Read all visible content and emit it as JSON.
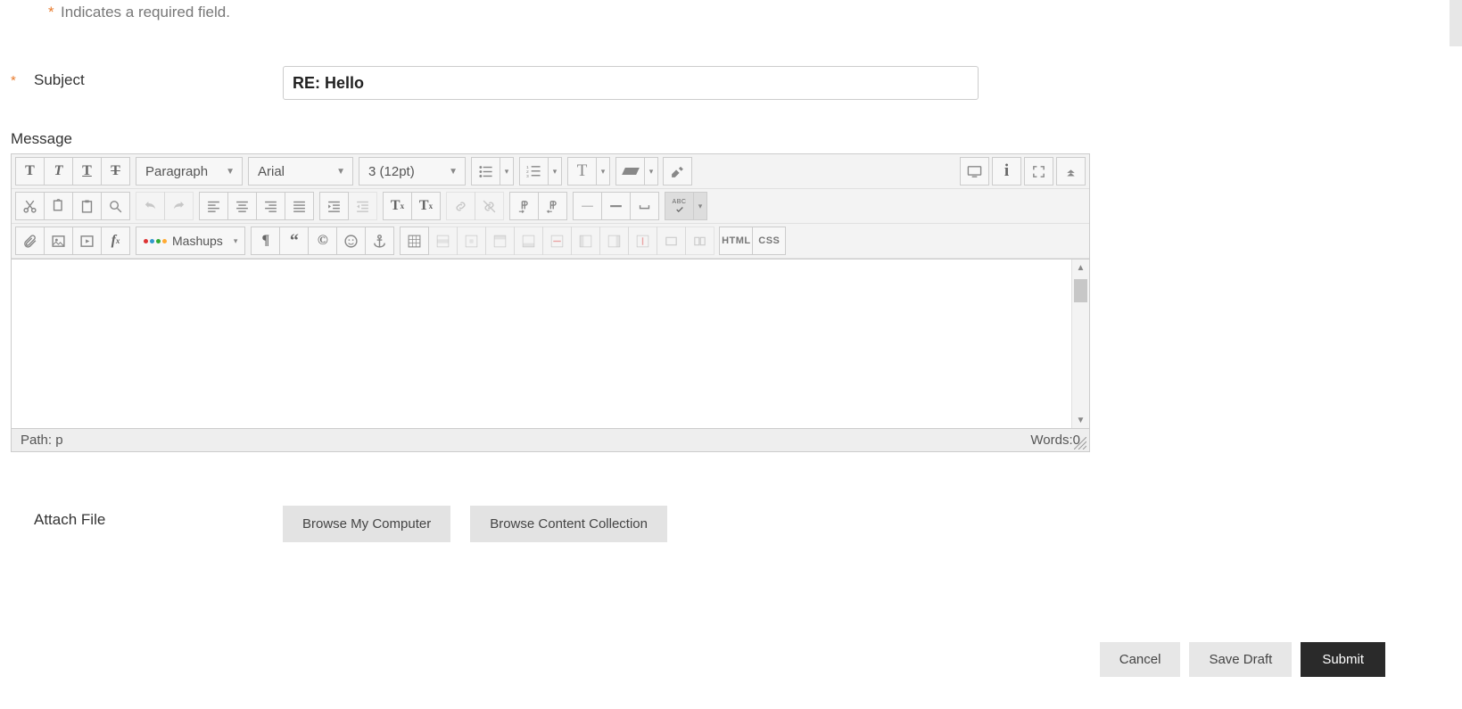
{
  "required_note": {
    "asterisk": "*",
    "text": "Indicates a required field."
  },
  "subject": {
    "asterisk": "*",
    "label": "Subject",
    "value": "RE: Hello"
  },
  "message": {
    "label": "Message"
  },
  "toolbar": {
    "format_select": "Paragraph",
    "font_select": "Arial",
    "size_select": "3 (12pt)",
    "mashups_label": "Mashups",
    "html_label": "HTML",
    "css_label": "CSS"
  },
  "editor_status": {
    "path_label": "Path: ",
    "path_value": "p",
    "words_label": "Words:",
    "words_value": "0"
  },
  "attach": {
    "label": "Attach File",
    "browse_computer": "Browse My Computer",
    "browse_collection": "Browse Content Collection"
  },
  "footer": {
    "cancel": "Cancel",
    "save_draft": "Save Draft",
    "submit": "Submit"
  }
}
